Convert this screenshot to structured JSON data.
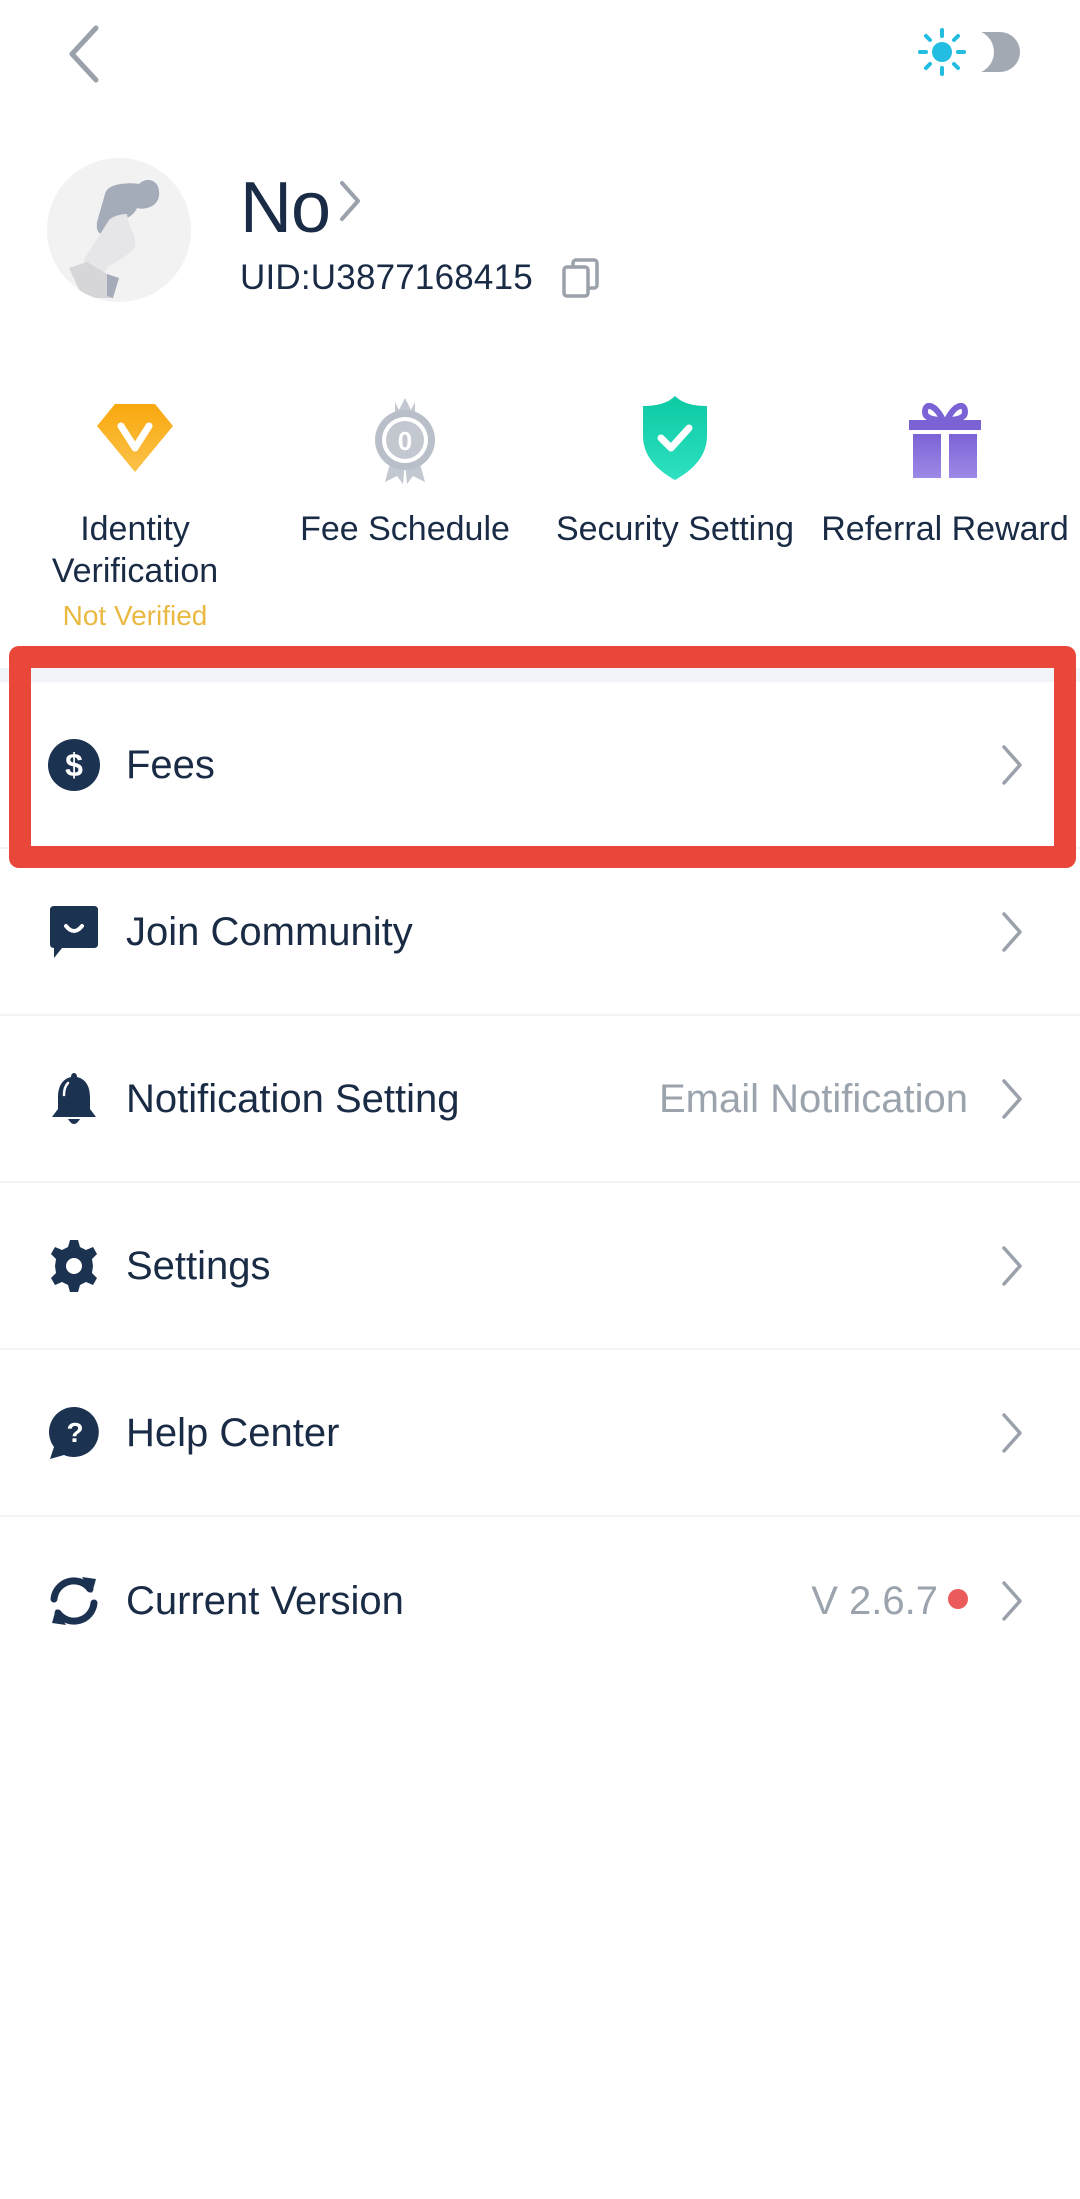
{
  "header": {
    "back_icon": "chevron-left-icon",
    "theme_toggle": {
      "icon": "sun-icon",
      "mode": "light",
      "sun_color": "#22bde0",
      "track_color": "#a3a9b3"
    }
  },
  "profile": {
    "name": "No",
    "uid": "UID:U3877168415",
    "avatar_icon": "default-avatar-icon",
    "copy_icon": "copy-icon"
  },
  "quick_actions": [
    {
      "label_line1": "Identity",
      "label_line2": "Verification",
      "status": "Not Verified",
      "icon": "diamond-verify-icon",
      "status_color": "#e9b941"
    },
    {
      "label_line1": "Fee Schedule",
      "label_line2": "",
      "icon": "level-badge-icon",
      "badge_value": "0"
    },
    {
      "label_line1": "Security Setting",
      "label_line2": "",
      "icon": "shield-check-icon"
    },
    {
      "label_line1": "Referral Reward",
      "label_line2": "",
      "icon": "gift-icon"
    }
  ],
  "menu": [
    {
      "label": "Fees",
      "value": "",
      "icon": "dollar-circle-icon",
      "highlighted": true
    },
    {
      "label": "Join Community",
      "value": "",
      "icon": "chat-bubble-icon"
    },
    {
      "label": "Notification Setting",
      "value": "Email Notification",
      "icon": "bell-icon"
    },
    {
      "label": "Settings",
      "value": "",
      "icon": "gear-icon"
    },
    {
      "label": "Help Center",
      "value": "",
      "icon": "help-bubble-icon"
    },
    {
      "label": "Current Version",
      "value": "V 2.6.7",
      "icon": "refresh-icon",
      "update_dot": true
    }
  ],
  "colors": {
    "text_primary": "#1a2b45",
    "text_secondary": "#9ba3ad",
    "highlight_border": "#e8473a",
    "update_dot": "#ec5b5b",
    "band": "#f1f4f9"
  }
}
